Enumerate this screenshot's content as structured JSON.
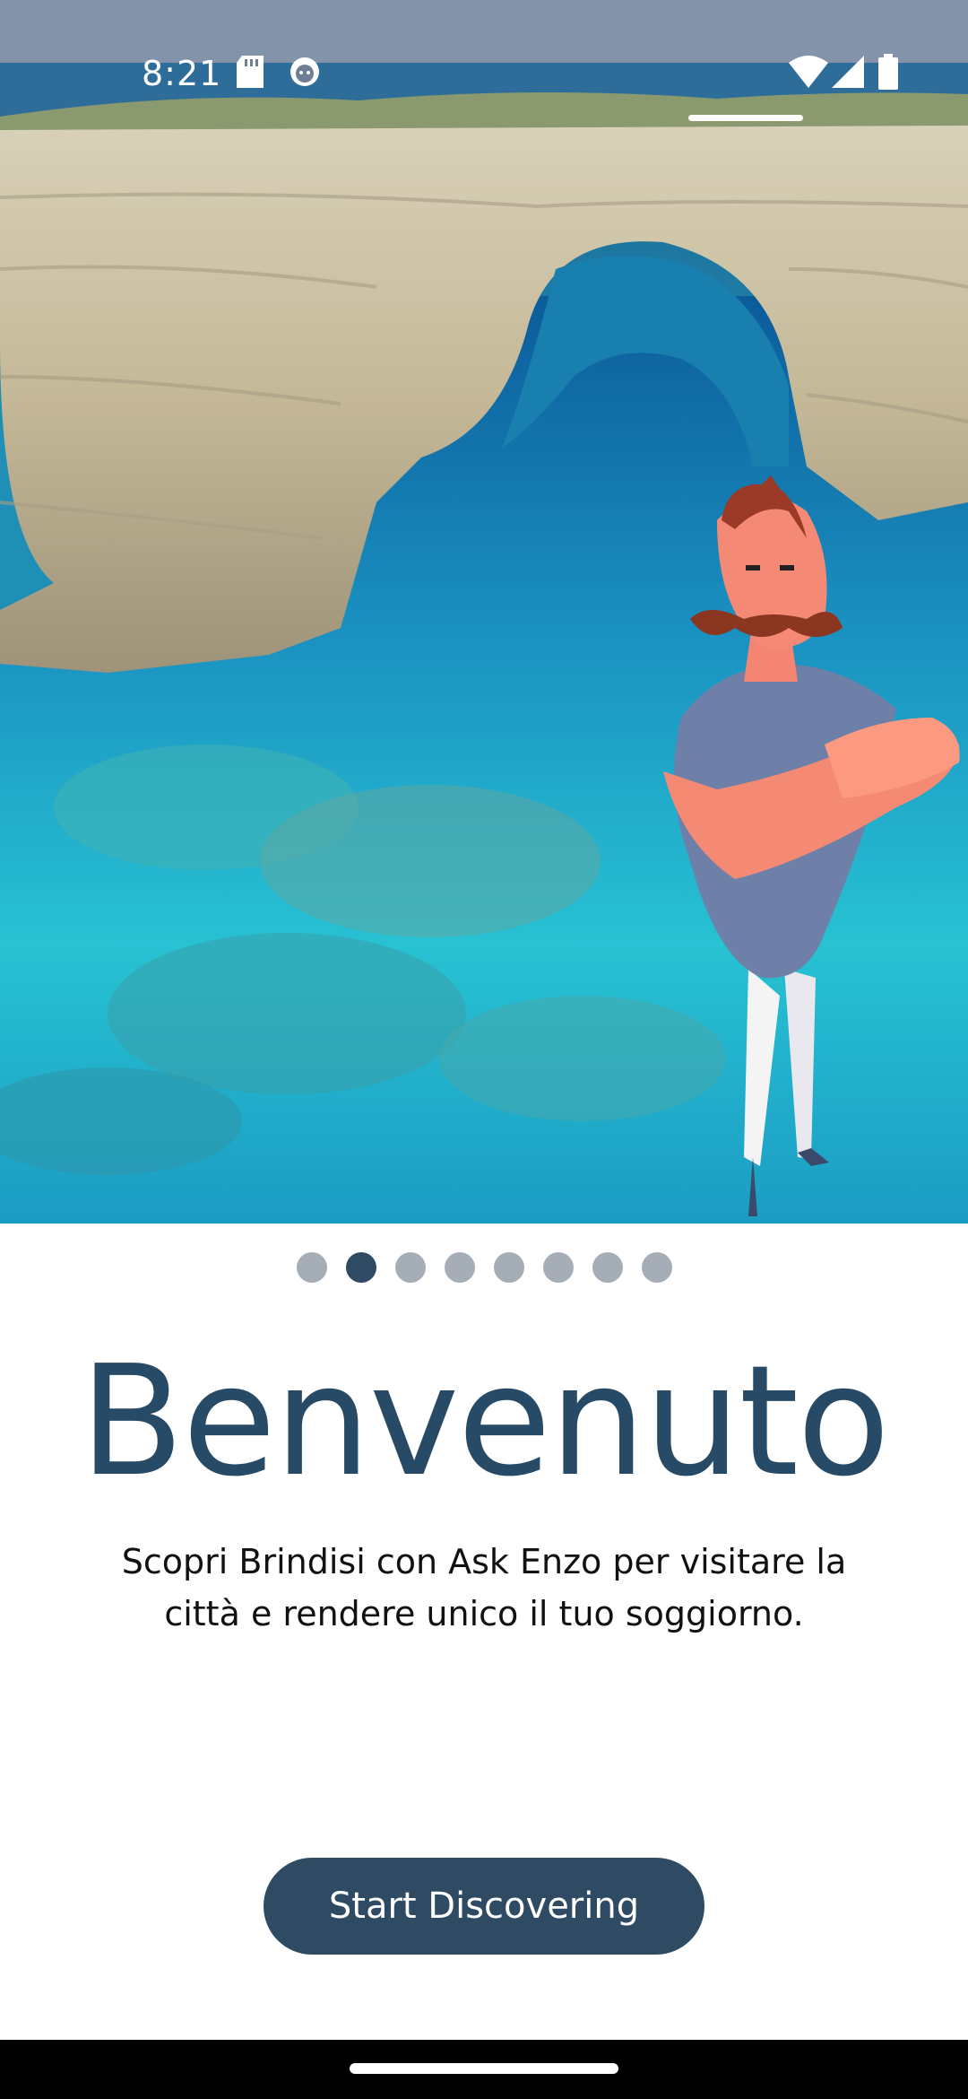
{
  "status_bar": {
    "time": "8:21",
    "icons": [
      "sd-card-icon",
      "android-debug-icon",
      "wifi-icon",
      "signal-icon",
      "battery-icon"
    ]
  },
  "hero": {
    "image": "sea-cliffs-with-mascot"
  },
  "pager": {
    "total": 8,
    "active_index": 1
  },
  "content": {
    "title": "Benvenuto",
    "subtitle": "Scopri Brindisi con Ask Enzo per visitare la città e rendere unico il tuo soggiorno."
  },
  "cta": {
    "label": "Start Discovering"
  },
  "colors": {
    "primary": "#2f4a63",
    "title": "#274a66",
    "dot_inactive": "#a5adb6"
  }
}
